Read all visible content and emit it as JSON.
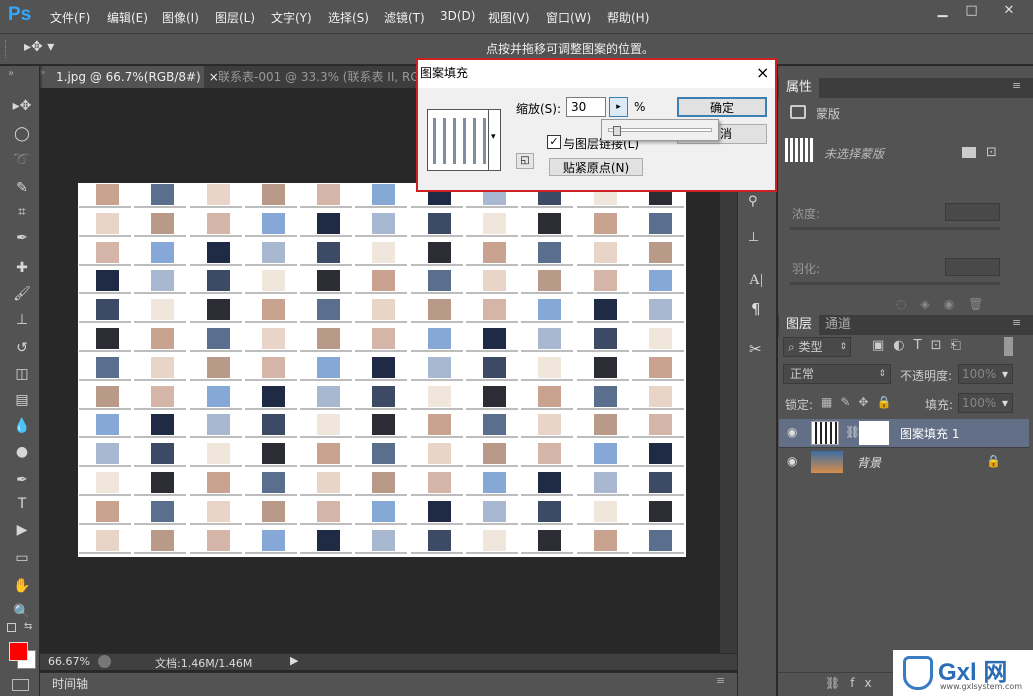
{
  "app": {
    "logo": "Ps"
  },
  "menu": [
    "文件(F)",
    "编辑(E)",
    "图像(I)",
    "图层(L)",
    "文字(Y)",
    "选择(S)",
    "滤镜(T)",
    "3D(D)",
    "视图(V)",
    "窗口(W)",
    "帮助(H)"
  ],
  "options": {
    "hint": "点按并拖移可调整图案的位置。"
  },
  "tabs": [
    {
      "label": "1.jpg @ 66.7%(RGB/8#)",
      "close": "×",
      "active": true
    },
    {
      "label": "联系表-001 @ 33.3% (联系表 II, RGB",
      "active": false
    }
  ],
  "status": {
    "zoom": "66.67%",
    "doc": "文档:1.46M/1.46M"
  },
  "timeline": {
    "label": "时间轴"
  },
  "dialog": {
    "title": "图案填充",
    "close": "×",
    "scale_label": "缩放(S):",
    "scale_value": "30",
    "percent": "%",
    "ok": "确定",
    "cancel": "消",
    "link": "与图层链接(L)",
    "snap": "贴紧原点(N)",
    "link_checked": true,
    "slider_fraction": 0.05
  },
  "properties": {
    "tab": "属性",
    "mask_label": "蒙版",
    "no_mask": "未选择蒙版",
    "density": "浓度:",
    "feather": "羽化:"
  },
  "layers_panel": {
    "tab_layers": "图层",
    "tab_channels": "通道",
    "filter": "类型",
    "blend": "正常",
    "opacity_label": "不透明度:",
    "opacity": "100%",
    "lock_label": "锁定:",
    "fill_label": "填充:",
    "fill": "100%",
    "layers": [
      {
        "name": "图案填充 1",
        "selected": true
      },
      {
        "name": "背景",
        "locked": true
      }
    ]
  },
  "watermark": {
    "text": "Gxl 网",
    "url": "www.gxlsystem.com"
  },
  "colors": {
    "accent": "#31a8ff",
    "foreground": "#ff0000",
    "background": "#ffffff",
    "highlight": "#cc2222"
  }
}
